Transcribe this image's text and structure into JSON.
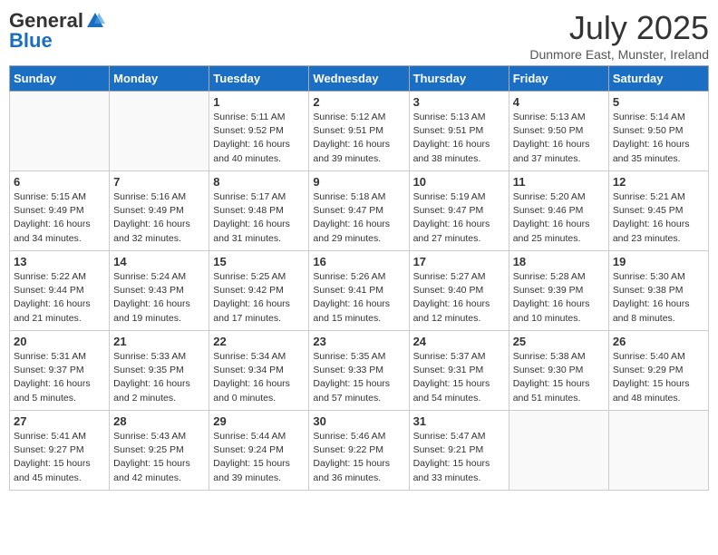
{
  "header": {
    "logo_general": "General",
    "logo_blue": "Blue",
    "month": "July 2025",
    "location": "Dunmore East, Munster, Ireland"
  },
  "days_of_week": [
    "Sunday",
    "Monday",
    "Tuesday",
    "Wednesday",
    "Thursday",
    "Friday",
    "Saturday"
  ],
  "weeks": [
    [
      {
        "day": "",
        "info": ""
      },
      {
        "day": "",
        "info": ""
      },
      {
        "day": "1",
        "info": "Sunrise: 5:11 AM\nSunset: 9:52 PM\nDaylight: 16 hours\nand 40 minutes."
      },
      {
        "day": "2",
        "info": "Sunrise: 5:12 AM\nSunset: 9:51 PM\nDaylight: 16 hours\nand 39 minutes."
      },
      {
        "day": "3",
        "info": "Sunrise: 5:13 AM\nSunset: 9:51 PM\nDaylight: 16 hours\nand 38 minutes."
      },
      {
        "day": "4",
        "info": "Sunrise: 5:13 AM\nSunset: 9:50 PM\nDaylight: 16 hours\nand 37 minutes."
      },
      {
        "day": "5",
        "info": "Sunrise: 5:14 AM\nSunset: 9:50 PM\nDaylight: 16 hours\nand 35 minutes."
      }
    ],
    [
      {
        "day": "6",
        "info": "Sunrise: 5:15 AM\nSunset: 9:49 PM\nDaylight: 16 hours\nand 34 minutes."
      },
      {
        "day": "7",
        "info": "Sunrise: 5:16 AM\nSunset: 9:49 PM\nDaylight: 16 hours\nand 32 minutes."
      },
      {
        "day": "8",
        "info": "Sunrise: 5:17 AM\nSunset: 9:48 PM\nDaylight: 16 hours\nand 31 minutes."
      },
      {
        "day": "9",
        "info": "Sunrise: 5:18 AM\nSunset: 9:47 PM\nDaylight: 16 hours\nand 29 minutes."
      },
      {
        "day": "10",
        "info": "Sunrise: 5:19 AM\nSunset: 9:47 PM\nDaylight: 16 hours\nand 27 minutes."
      },
      {
        "day": "11",
        "info": "Sunrise: 5:20 AM\nSunset: 9:46 PM\nDaylight: 16 hours\nand 25 minutes."
      },
      {
        "day": "12",
        "info": "Sunrise: 5:21 AM\nSunset: 9:45 PM\nDaylight: 16 hours\nand 23 minutes."
      }
    ],
    [
      {
        "day": "13",
        "info": "Sunrise: 5:22 AM\nSunset: 9:44 PM\nDaylight: 16 hours\nand 21 minutes."
      },
      {
        "day": "14",
        "info": "Sunrise: 5:24 AM\nSunset: 9:43 PM\nDaylight: 16 hours\nand 19 minutes."
      },
      {
        "day": "15",
        "info": "Sunrise: 5:25 AM\nSunset: 9:42 PM\nDaylight: 16 hours\nand 17 minutes."
      },
      {
        "day": "16",
        "info": "Sunrise: 5:26 AM\nSunset: 9:41 PM\nDaylight: 16 hours\nand 15 minutes."
      },
      {
        "day": "17",
        "info": "Sunrise: 5:27 AM\nSunset: 9:40 PM\nDaylight: 16 hours\nand 12 minutes."
      },
      {
        "day": "18",
        "info": "Sunrise: 5:28 AM\nSunset: 9:39 PM\nDaylight: 16 hours\nand 10 minutes."
      },
      {
        "day": "19",
        "info": "Sunrise: 5:30 AM\nSunset: 9:38 PM\nDaylight: 16 hours\nand 8 minutes."
      }
    ],
    [
      {
        "day": "20",
        "info": "Sunrise: 5:31 AM\nSunset: 9:37 PM\nDaylight: 16 hours\nand 5 minutes."
      },
      {
        "day": "21",
        "info": "Sunrise: 5:33 AM\nSunset: 9:35 PM\nDaylight: 16 hours\nand 2 minutes."
      },
      {
        "day": "22",
        "info": "Sunrise: 5:34 AM\nSunset: 9:34 PM\nDaylight: 16 hours\nand 0 minutes."
      },
      {
        "day": "23",
        "info": "Sunrise: 5:35 AM\nSunset: 9:33 PM\nDaylight: 15 hours\nand 57 minutes."
      },
      {
        "day": "24",
        "info": "Sunrise: 5:37 AM\nSunset: 9:31 PM\nDaylight: 15 hours\nand 54 minutes."
      },
      {
        "day": "25",
        "info": "Sunrise: 5:38 AM\nSunset: 9:30 PM\nDaylight: 15 hours\nand 51 minutes."
      },
      {
        "day": "26",
        "info": "Sunrise: 5:40 AM\nSunset: 9:29 PM\nDaylight: 15 hours\nand 48 minutes."
      }
    ],
    [
      {
        "day": "27",
        "info": "Sunrise: 5:41 AM\nSunset: 9:27 PM\nDaylight: 15 hours\nand 45 minutes."
      },
      {
        "day": "28",
        "info": "Sunrise: 5:43 AM\nSunset: 9:25 PM\nDaylight: 15 hours\nand 42 minutes."
      },
      {
        "day": "29",
        "info": "Sunrise: 5:44 AM\nSunset: 9:24 PM\nDaylight: 15 hours\nand 39 minutes."
      },
      {
        "day": "30",
        "info": "Sunrise: 5:46 AM\nSunset: 9:22 PM\nDaylight: 15 hours\nand 36 minutes."
      },
      {
        "day": "31",
        "info": "Sunrise: 5:47 AM\nSunset: 9:21 PM\nDaylight: 15 hours\nand 33 minutes."
      },
      {
        "day": "",
        "info": ""
      },
      {
        "day": "",
        "info": ""
      }
    ]
  ]
}
